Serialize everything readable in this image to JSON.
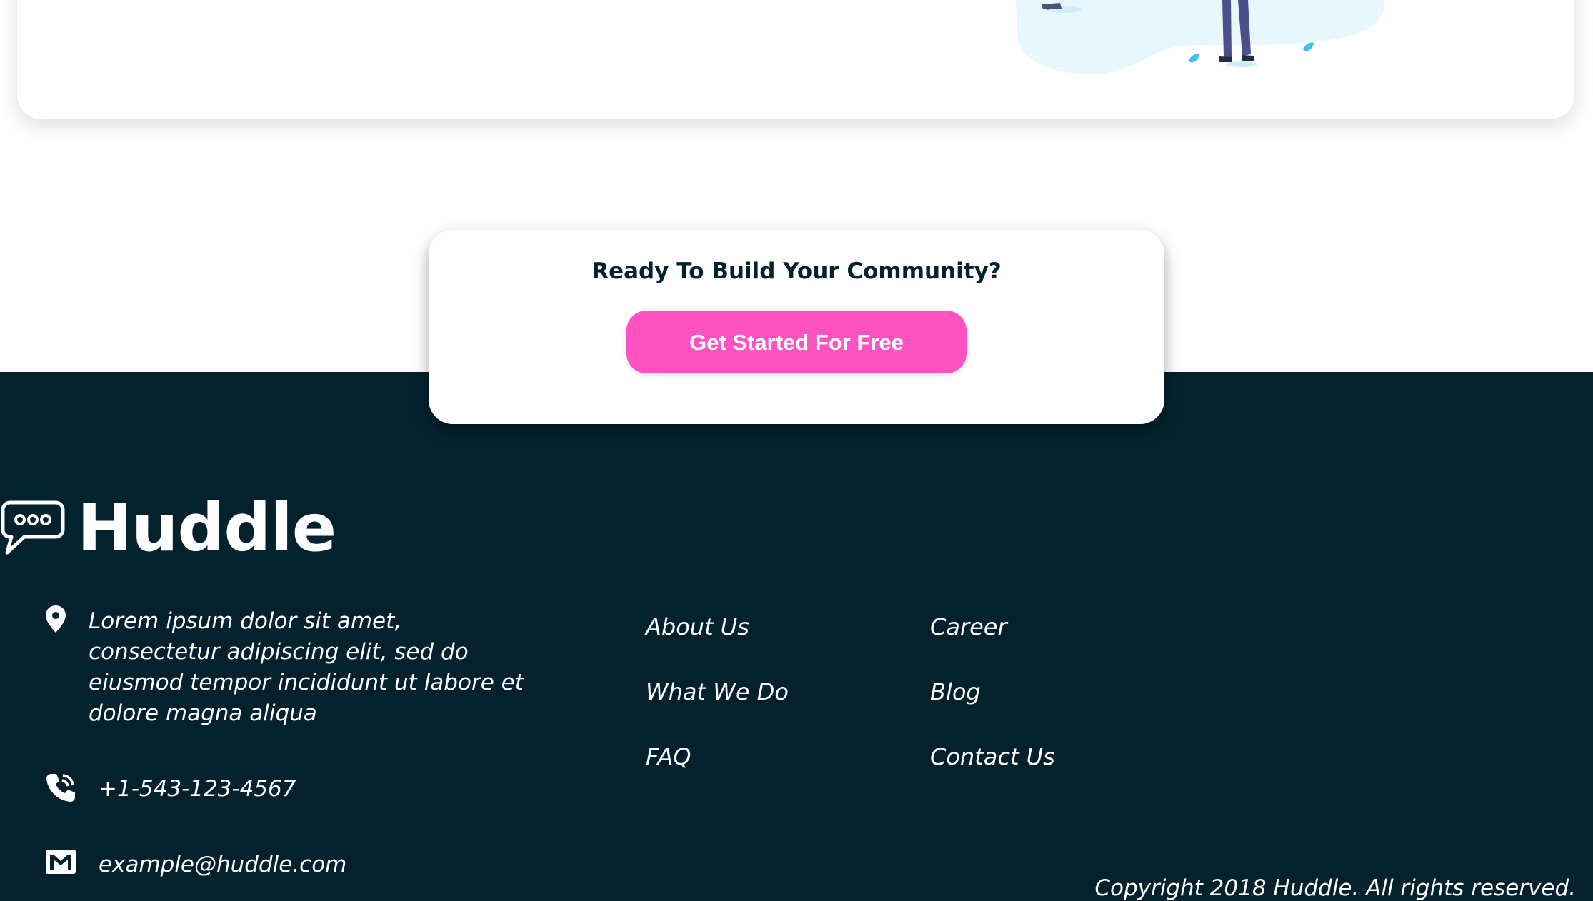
{
  "cta": {
    "title": "Ready To Build Your Community?",
    "button_label": "Get Started For Free"
  },
  "footer": {
    "brand": "Huddle",
    "address": "Lorem ipsum dolor sit amet, consectetur adipiscing elit, sed do eiusmod tempor incididunt ut labore et dolore magna aliqua",
    "phone": "+1-543-123-4567",
    "email": "example@huddle.com",
    "links_col1": [
      "About Us",
      "What We Do",
      "FAQ"
    ],
    "links_col2": [
      "Career",
      "Blog",
      "Contact Us"
    ],
    "copyright": "Copyright 2018 Huddle. All rights reserved."
  },
  "icons": {
    "logo": "chat-bubble-icon",
    "address": "location-pin-icon",
    "phone": "phone-icon",
    "email": "mail-icon"
  },
  "colors": {
    "footer_bg": "#04222e",
    "accent": "#ff52c1",
    "card_bg": "#ffffff",
    "text_dark": "#04222e",
    "illustration_blob": "#e6f8fd"
  }
}
